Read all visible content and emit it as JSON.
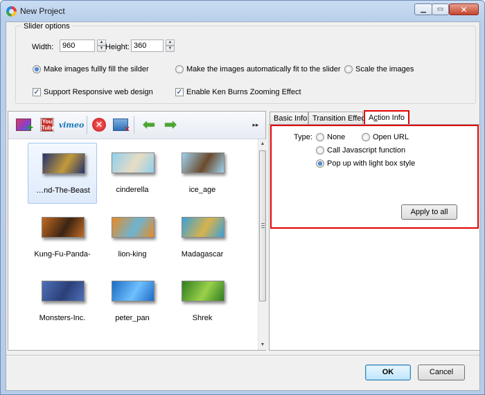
{
  "window": {
    "title": "New Project"
  },
  "slider_options": {
    "legend": "Slider options",
    "width_label": "Width:",
    "width_value": "960",
    "height_label": "Height:",
    "height_value": "360",
    "fit_modes": [
      {
        "label": "Make images fullly fill the silder",
        "selected": true
      },
      {
        "label": "Make the images automatically fit to the slider",
        "selected": false
      },
      {
        "label": "Scale the images",
        "selected": false
      }
    ],
    "responsive_label": "Support Responsive web design",
    "responsive_checked": true,
    "kenburns_label": "Enable Ken Burns Zooming Effect",
    "kenburns_checked": true
  },
  "toolbar": {
    "youtube_top": "You",
    "youtube_bottom": "Tube",
    "vimeo_text": "vimeo",
    "more_glyph": "▸▸"
  },
  "thumbnails": [
    {
      "caption": "…nd-The-Beast",
      "selected": true,
      "colors": [
        "#24336e",
        "#c39a3a"
      ]
    },
    {
      "caption": "cinderella",
      "selected": false,
      "colors": [
        "#8fd0ee",
        "#e8dcc4"
      ]
    },
    {
      "caption": "ice_age",
      "selected": false,
      "colors": [
        "#9ed3f0",
        "#6b4a2c"
      ]
    },
    {
      "caption": "Kung-Fu-Panda-",
      "selected": false,
      "colors": [
        "#c26a21",
        "#3c2414"
      ]
    },
    {
      "caption": "lion-king",
      "selected": false,
      "colors": [
        "#e98a24",
        "#6cb4d4"
      ]
    },
    {
      "caption": "Madagascar",
      "selected": false,
      "colors": [
        "#3aa0d8",
        "#d8b24c"
      ]
    },
    {
      "caption": "Monsters-Inc.",
      "selected": false,
      "colors": [
        "#4e70b8",
        "#2b3f77"
      ]
    },
    {
      "caption": "peter_pan",
      "selected": false,
      "colors": [
        "#1c6cc4",
        "#6fc0ff"
      ]
    },
    {
      "caption": "Shrek",
      "selected": false,
      "colors": [
        "#2f7d1f",
        "#9ad14a"
      ]
    }
  ],
  "tabs": {
    "basic_info": "Basic Info",
    "transition_effect": "Transition Effect",
    "action_info_pre": "A",
    "action_info_mid": "c",
    "action_info_post": "tion Info"
  },
  "action_info": {
    "type_label": "Type:",
    "options": [
      {
        "label": "None",
        "selected": false
      },
      {
        "label": "Open URL",
        "selected": false
      },
      {
        "label": "Call Javascript function",
        "selected": false
      },
      {
        "label": "Pop up with light box style",
        "selected": true
      }
    ],
    "apply_label": "Apply to all"
  },
  "buttons": {
    "ok": "OK",
    "cancel": "Cancel"
  },
  "colors": {
    "highlight_red": "#e00000",
    "selection_blue": "#a5c6ee"
  }
}
